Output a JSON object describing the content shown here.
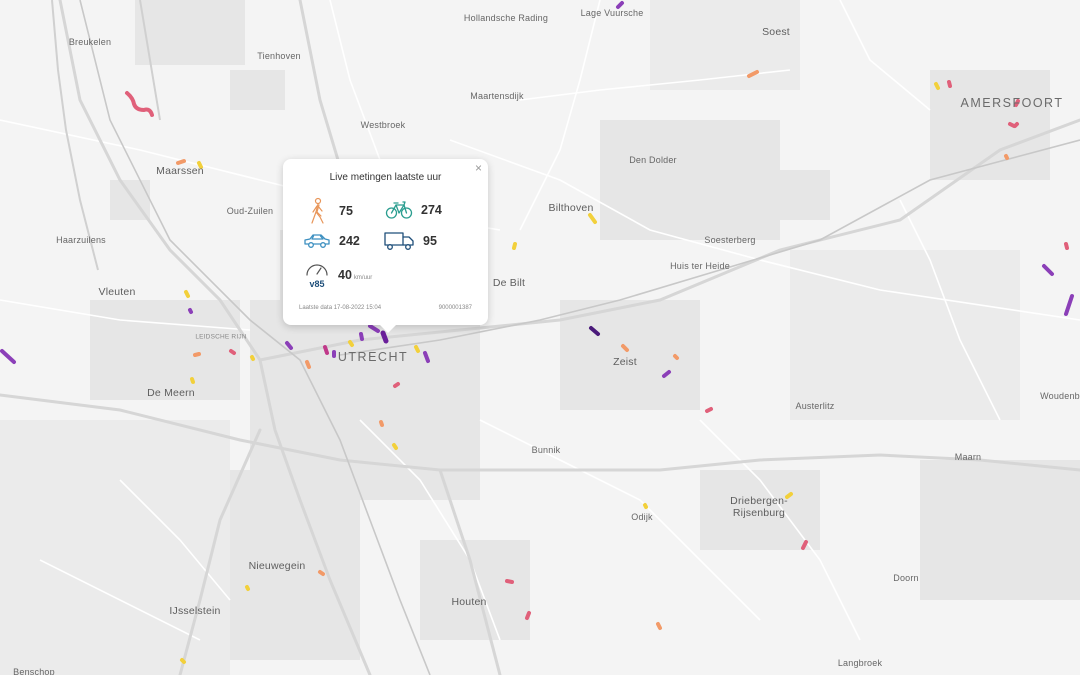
{
  "map": {
    "places": [
      {
        "name": "Breukelen",
        "cls": "place"
      },
      {
        "name": "Tienhoven",
        "cls": "place"
      },
      {
        "name": "Hollandsche Rading",
        "cls": "place"
      },
      {
        "name": "Lage Vuursche",
        "cls": "place"
      },
      {
        "name": "Soest",
        "cls": "place town"
      },
      {
        "name": "Maartensdijk",
        "cls": "place"
      },
      {
        "name": "Westbroek",
        "cls": "place"
      },
      {
        "name": "Maarssen",
        "cls": "place town"
      },
      {
        "name": "Oud-Zuilen",
        "cls": "place"
      },
      {
        "name": "Den Dolder",
        "cls": "place"
      },
      {
        "name": "Bilthoven",
        "cls": "place town"
      },
      {
        "name": "Haarzuilens",
        "cls": "place"
      },
      {
        "name": "Soesterberg",
        "cls": "place"
      },
      {
        "name": "Huis ter Heide",
        "cls": "place"
      },
      {
        "name": "De Bilt",
        "cls": "place town"
      },
      {
        "name": "Vleuten",
        "cls": "place town"
      },
      {
        "name": "LEIDSCHE RIJN",
        "cls": "place muni"
      },
      {
        "name": "UTRECHT",
        "cls": "place city"
      },
      {
        "name": "Zeist",
        "cls": "place town"
      },
      {
        "name": "De Meern",
        "cls": "place town"
      },
      {
        "name": "Austerlitz",
        "cls": "place"
      },
      {
        "name": "Bunnik",
        "cls": "place"
      },
      {
        "name": "Maarn",
        "cls": "place"
      },
      {
        "name": "Driebergen-",
        "cls": "place town"
      },
      {
        "name": "Rijsenburg",
        "cls": "place town"
      },
      {
        "name": "Odijk",
        "cls": "place"
      },
      {
        "name": "Nieuwegein",
        "cls": "place town"
      },
      {
        "name": "Doorn",
        "cls": "place"
      },
      {
        "name": "Houten",
        "cls": "place town"
      },
      {
        "name": "IJsselstein",
        "cls": "place town"
      },
      {
        "name": "Langbroek",
        "cls": "place"
      },
      {
        "name": "Benschop",
        "cls": "place"
      },
      {
        "name": "AMERSFOORT",
        "cls": "place city"
      },
      {
        "name": "Woudenb",
        "cls": "place"
      }
    ]
  },
  "popup": {
    "title": "Live metingen laatste uur",
    "close": "×",
    "pedestrians": "75",
    "cyclists": "274",
    "cars": "242",
    "trucks": "95",
    "v85": "40",
    "v85_unit": "km/uur",
    "v85_icon_label": "v85",
    "last_data": "Laatste data 17-08-2022 15:04",
    "sensor_id": "9000001387"
  },
  "colors": {
    "yellow": "#f2d03b",
    "orange": "#f29a68",
    "pink": "#e0607a",
    "magenta": "#c0398a",
    "purple": "#8b3fb8",
    "dark_purple": "#4a1a7a",
    "icon_orange": "#e8965a",
    "icon_teal": "#2a9d8f",
    "icon_blue": "#3c8fc0",
    "icon_navy": "#1f4f7a"
  }
}
